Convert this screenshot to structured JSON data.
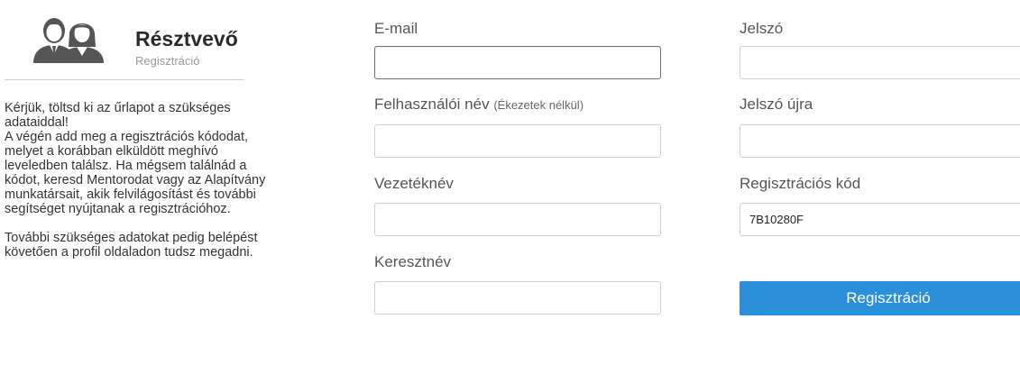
{
  "header": {
    "title": "Résztvevő",
    "subtitle": "Regisztráció",
    "icon": "users-icon"
  },
  "intro": {
    "paragraph1": "Kérjük, töltsd ki az űrlapot a szükséges adataiddal!\nA végén add meg a regisztrációs kódodat, melyet a korábban elküldött meghívó leveledben találsz. Ha mégsem találnád a kódot, keresd Mentorodat vagy az Alapítvány munkatársait, akik felvilágosítást és további segítséget nyújtanak a regisztrációhoz.",
    "paragraph2": "További szükséges adatokat pedig belépést követően a profil oldaladon tudsz megadni."
  },
  "form": {
    "email": {
      "label": "E-mail",
      "value": ""
    },
    "username": {
      "label": "Felhasználói név",
      "hint": "(Ékezetek nélkül)",
      "value": ""
    },
    "lastname": {
      "label": "Vezetéknév",
      "value": ""
    },
    "firstname": {
      "label": "Keresztnév",
      "value": ""
    },
    "password": {
      "label": "Jelszó",
      "value": ""
    },
    "password_again": {
      "label": "Jelszó újra",
      "value": ""
    },
    "reg_code": {
      "label": "Regisztrációs kód",
      "value": "7B10280F"
    },
    "submit_label": "Regisztráció"
  },
  "colors": {
    "accent": "#2b8fd9",
    "icon": "#555555"
  }
}
